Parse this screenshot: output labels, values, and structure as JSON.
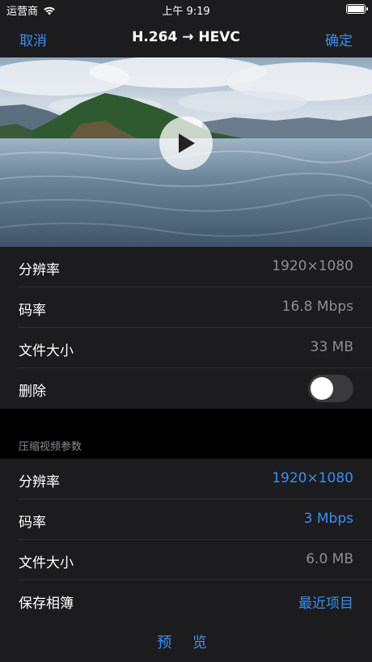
{
  "status_bar": {
    "carrier": "运营商",
    "time": "上午 9:19"
  },
  "nav": {
    "cancel": "取消",
    "title": "H.264 → HEVC",
    "confirm": "确定"
  },
  "original": {
    "rows": [
      {
        "label": "分辨率",
        "value": "1920×1080"
      },
      {
        "label": "码率",
        "value": "16.8 Mbps"
      },
      {
        "label": "文件大小",
        "value": "33 MB"
      }
    ],
    "delete_label": "删除",
    "delete_on": false
  },
  "compress": {
    "header": "压缩视频参数",
    "rows": [
      {
        "label": "分辨率",
        "value": "1920×1080"
      },
      {
        "label": "码率",
        "value": "3 Mbps"
      },
      {
        "label": "文件大小",
        "value": "6.0 MB"
      },
      {
        "label": "保存相簿",
        "value": "最近项目"
      }
    ]
  },
  "preview": "预 览",
  "colors": {
    "accent": "#3b8ef0",
    "background": "#000000",
    "cell": "#1c1c1e"
  }
}
